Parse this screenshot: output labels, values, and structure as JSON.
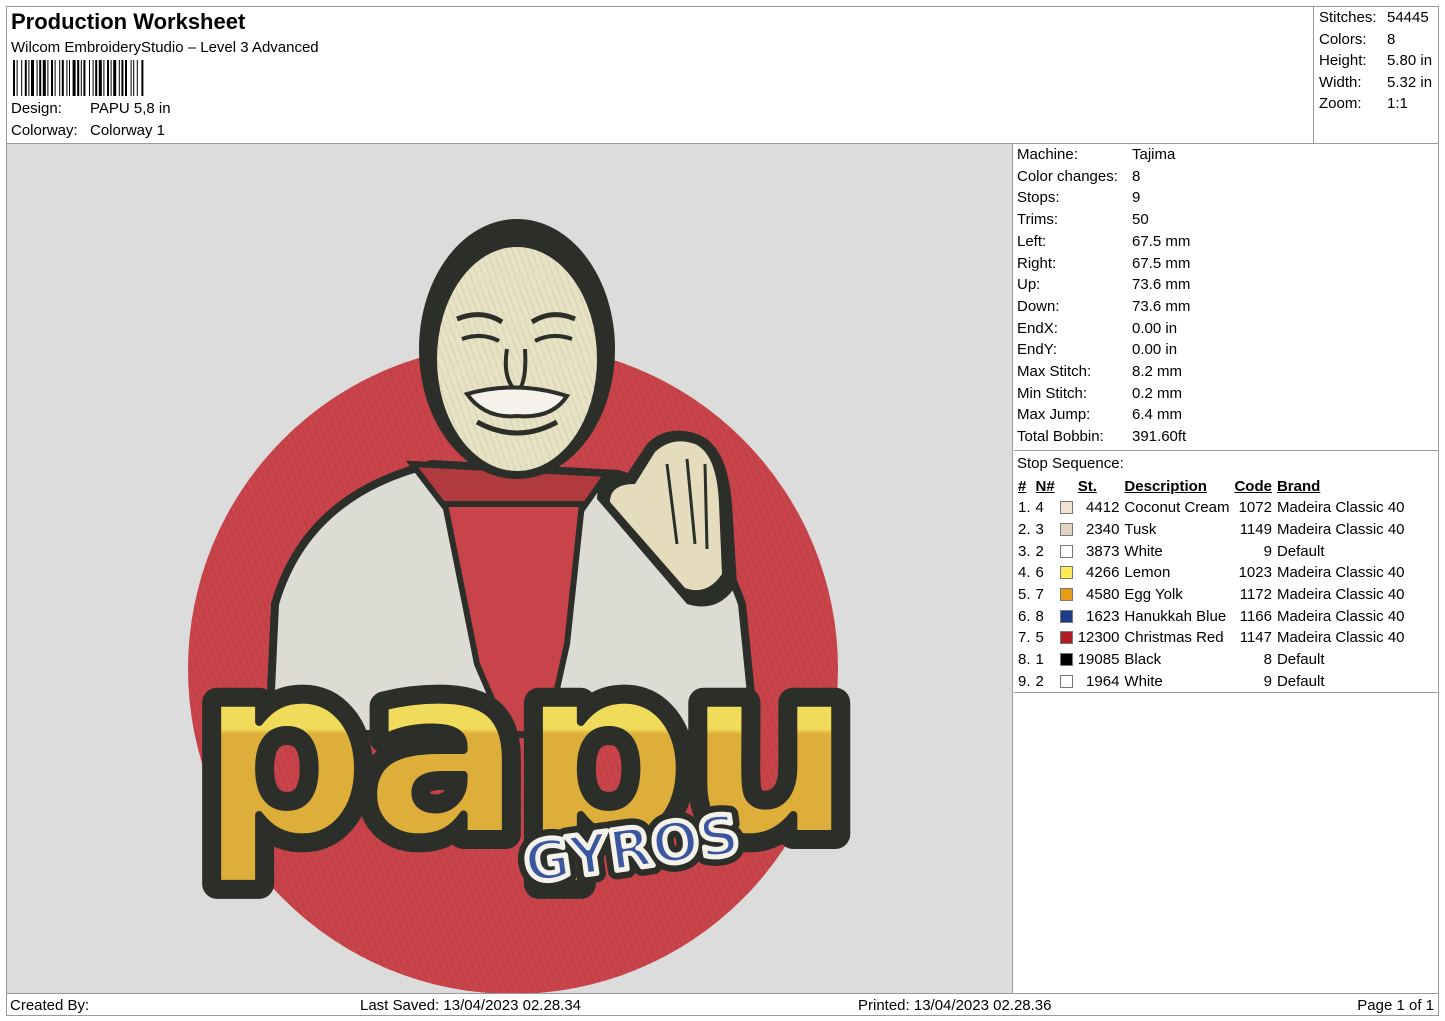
{
  "header": {
    "title": "Production Worksheet",
    "software": "Wilcom EmbroideryStudio – Level 3 Advanced",
    "design_label": "Design:",
    "design_value": "PAPU 5,8 in",
    "colorway_label": "Colorway:",
    "colorway_value": "Colorway 1"
  },
  "stats": [
    {
      "label": "Stitches:",
      "value": "54445"
    },
    {
      "label": "Colors:",
      "value": "8"
    },
    {
      "label": "Height:",
      "value": "5.80 in"
    },
    {
      "label": "Width:",
      "value": "5.32 in"
    },
    {
      "label": "Zoom:",
      "value": "1:1"
    }
  ],
  "machine_info": [
    {
      "label": "Machine:",
      "value": "Tajima"
    },
    {
      "label": "Color changes:",
      "value": "8"
    },
    {
      "label": "Stops:",
      "value": "9"
    },
    {
      "label": "Trims:",
      "value": "50"
    },
    {
      "label": "Left:",
      "value": "67.5 mm"
    },
    {
      "label": "Right:",
      "value": "67.5 mm"
    },
    {
      "label": "Up:",
      "value": "73.6 mm"
    },
    {
      "label": "Down:",
      "value": "73.6 mm"
    },
    {
      "label": "EndX:",
      "value": "0.00 in"
    },
    {
      "label": "EndY:",
      "value": "0.00 in"
    },
    {
      "label": "Max Stitch:",
      "value": "8.2 mm"
    },
    {
      "label": "Min Stitch:",
      "value": "0.2 mm"
    },
    {
      "label": "Max Jump:",
      "value": "6.4 mm"
    },
    {
      "label": "Total Bobbin:",
      "value": "391.60ft"
    }
  ],
  "stop_sequence": {
    "title": "Stop Sequence:",
    "headers": [
      "#",
      "N#",
      "St.",
      "Description",
      "Code",
      "Brand"
    ],
    "rows": [
      {
        "num": "1.",
        "n": "4",
        "color": "#f2e2d2",
        "st": "4412",
        "desc": "Coconut Cream",
        "code": "1072",
        "brand": "Madeira Classic 40"
      },
      {
        "num": "2.",
        "n": "3",
        "color": "#e2d2c2",
        "st": "2340",
        "desc": "Tusk",
        "code": "1149",
        "brand": "Madeira Classic 40"
      },
      {
        "num": "3.",
        "n": "2",
        "color": "#ffffff",
        "st": "3873",
        "desc": "White",
        "code": "9",
        "brand": "Default"
      },
      {
        "num": "4.",
        "n": "6",
        "color": "#fbeb5b",
        "st": "4266",
        "desc": "Lemon",
        "code": "1023",
        "brand": "Madeira Classic 40"
      },
      {
        "num": "5.",
        "n": "7",
        "color": "#e79c12",
        "st": "4580",
        "desc": "Egg Yolk",
        "code": "1172",
        "brand": "Madeira Classic 40"
      },
      {
        "num": "6.",
        "n": "8",
        "color": "#1c3c8c",
        "st": "1623",
        "desc": "Hanukkah Blue",
        "code": "1166",
        "brand": "Madeira Classic 40"
      },
      {
        "num": "7.",
        "n": "5",
        "color": "#b01c24",
        "st": "12300",
        "desc": "Christmas Red",
        "code": "1147",
        "brand": "Madeira Classic 40"
      },
      {
        "num": "8.",
        "n": "1",
        "color": "#000000",
        "st": "19085",
        "desc": "Black",
        "code": "8",
        "brand": "Default"
      },
      {
        "num": "9.",
        "n": "2",
        "color": "#ffffff",
        "st": "1964",
        "desc": "White",
        "code": "9",
        "brand": "Default"
      }
    ]
  },
  "design_art": {
    "logo_word": "papu",
    "logo_sub": "GYROS"
  },
  "footer": {
    "created_by": "Created By:",
    "last_saved": "Last Saved: 13/04/2023 02.28.34",
    "printed": "Printed: 13/04/2023 02.28.36",
    "page": "Page 1 of 1"
  }
}
